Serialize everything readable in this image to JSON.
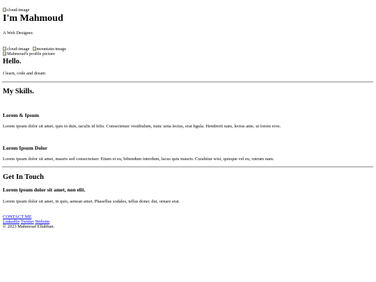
{
  "header": {
    "cloud_image_alt": "cloud-image",
    "title": "I'm Mahmoud",
    "subtitle": "A Web Designer.",
    "cloud_image_alt_2": "cloud-image",
    "mountain_image_alt": "mountain-image",
    "profile_image_alt": "Mahmoud's profile picture"
  },
  "intro": {
    "heading": "Hello.",
    "text": "I learn, code and dream"
  },
  "skills": {
    "heading": "My Skills.",
    "items": [
      {
        "title": "Lorem & Ipsum",
        "text": "Lorem ipsum dolor sit amet, quis in duis, iaculis id felis. Consectetuer vestibulum, nunc urna lectus, erat ligula. Hendrerit nam, lectus ante, ut lorem eros."
      },
      {
        "title": "Lorem Ipsum Dolor",
        "text": "Lorem ipsum dolor sit amet, mauris sed consectetuer. Etiam et eu, bibendum interdum, lacus quis mauris. Curabitur wisi, quisque vel eu, rutrum nam."
      }
    ]
  },
  "contact": {
    "heading": "Get In Touch",
    "subheading": "Lorem ipsum dolor sit amet, non elit.",
    "text": "Lorem ipsum dolor sit amet, in quis, aenean amet. Phasellus sodales, tellus donec dui, ornare erat.",
    "cta_label": "CONTACT ME"
  },
  "footer": {
    "links": [
      "LinkedIn",
      "Twitter",
      "Website"
    ],
    "copyright": "© 2023 Mahmoud Ellabban."
  },
  "colors": {
    "link": "#0000ee",
    "text": "#000000",
    "rule": "#9a9a9a"
  }
}
